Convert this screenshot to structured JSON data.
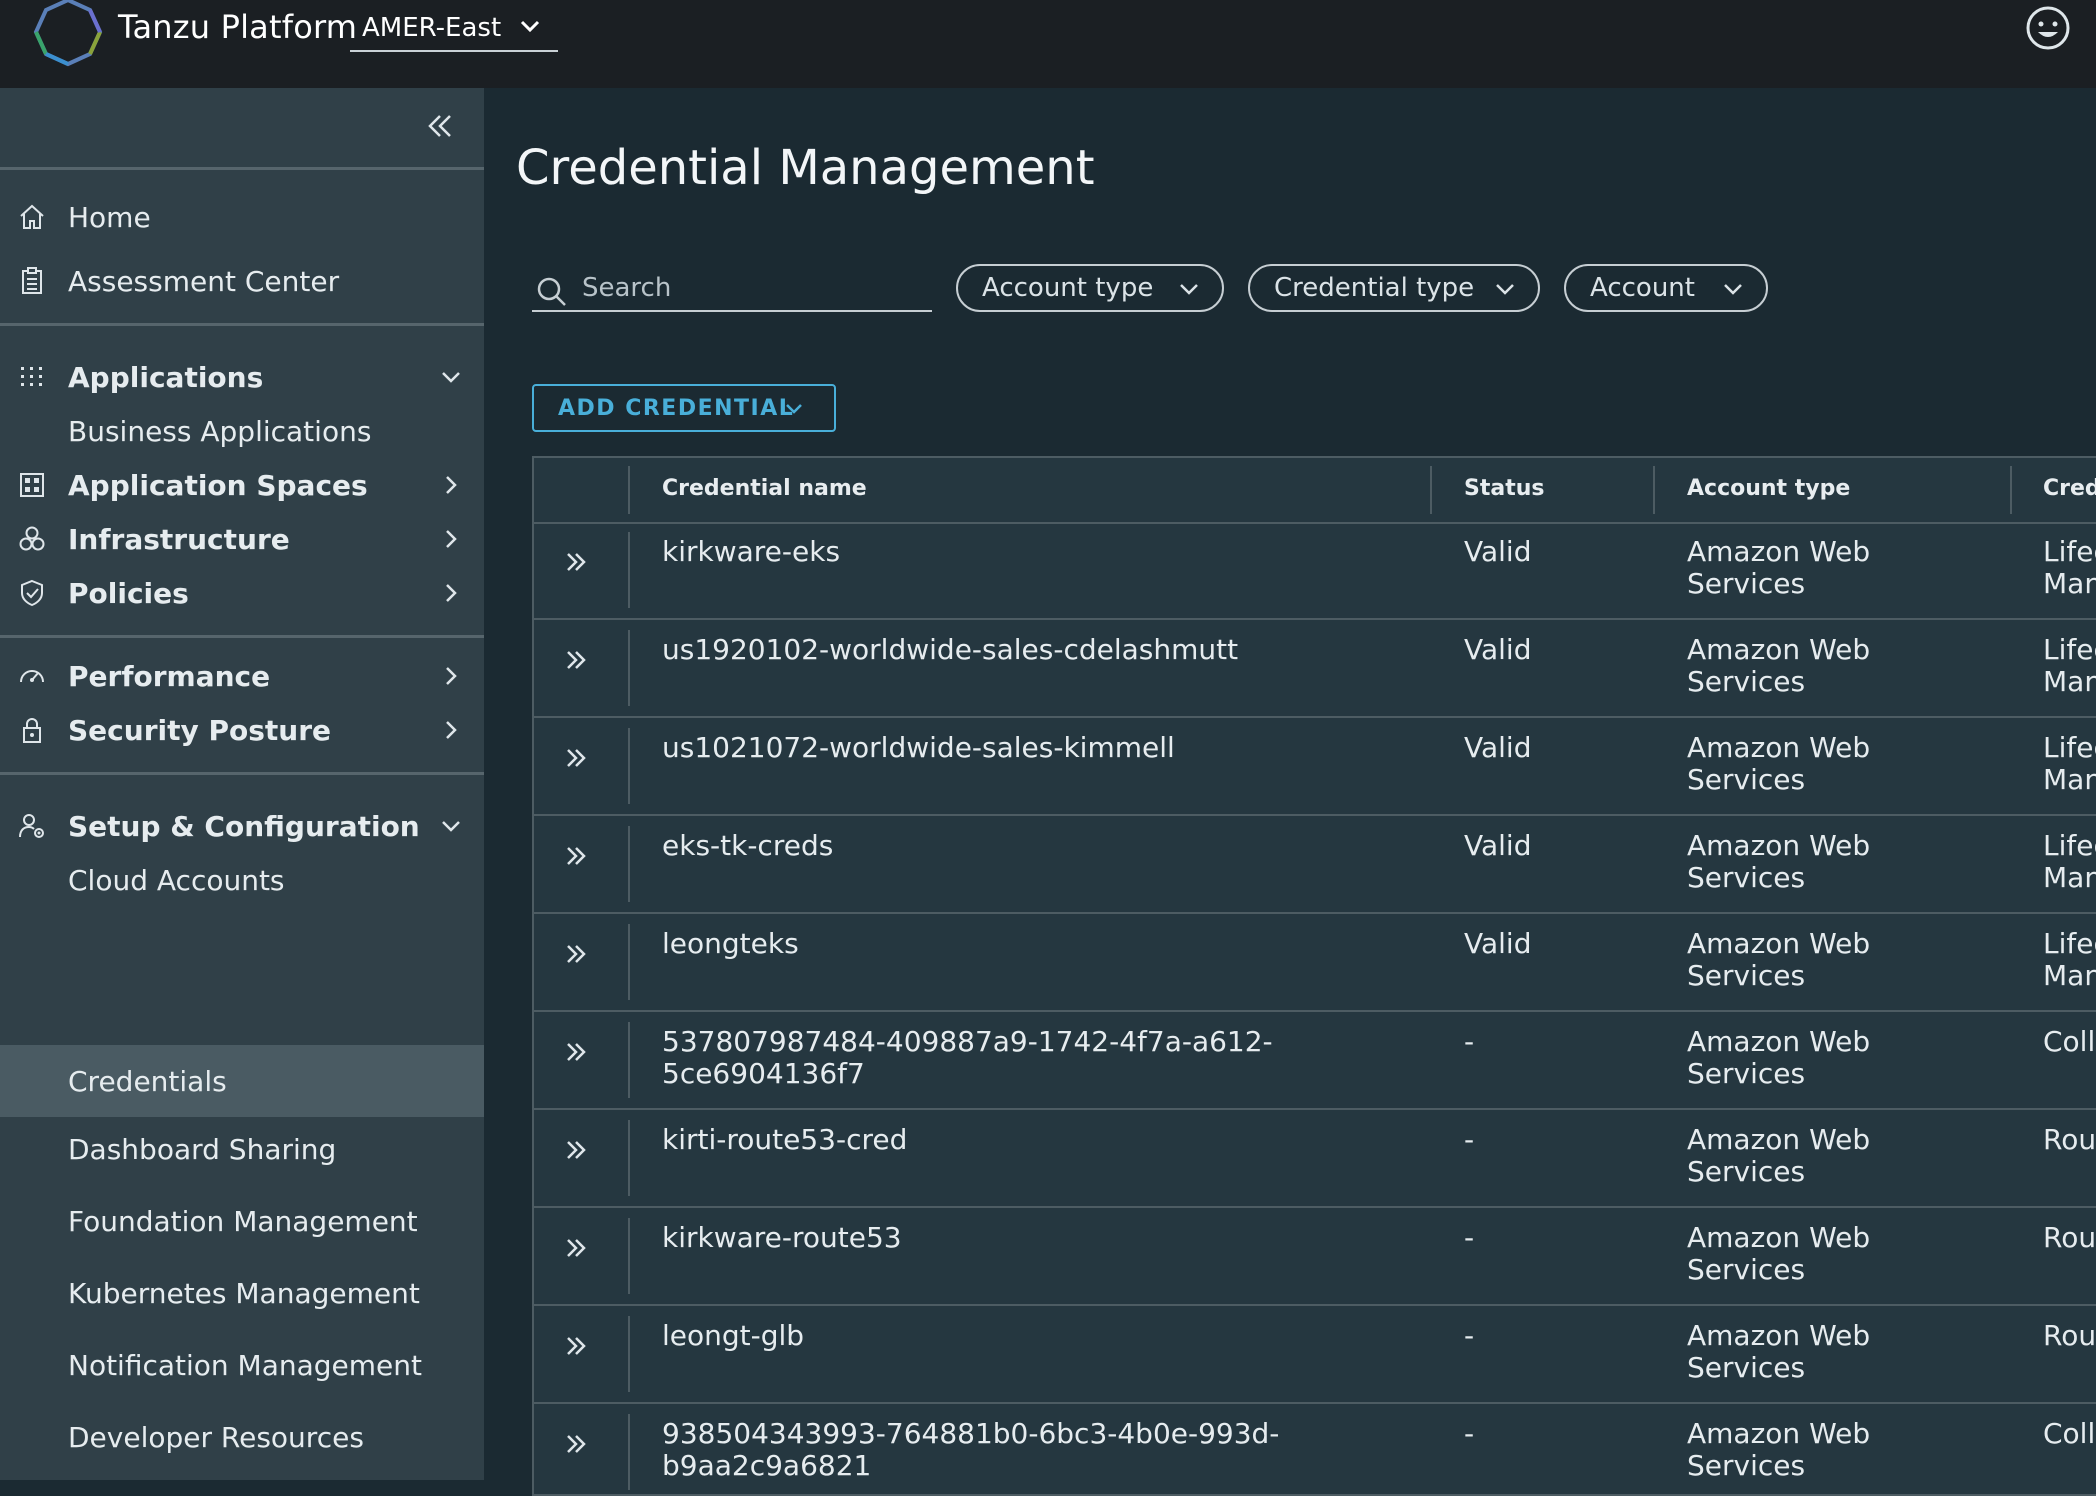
{
  "header": {
    "brand": "Tanzu Platform",
    "region": "AMER-East"
  },
  "sidebar": {
    "items": [
      {
        "label": "Home"
      },
      {
        "label": "Assessment Center"
      },
      {
        "label": "Applications"
      },
      {
        "label": "Business Applications"
      },
      {
        "label": "Application Spaces"
      },
      {
        "label": "Infrastructure"
      },
      {
        "label": "Policies"
      },
      {
        "label": "Performance"
      },
      {
        "label": "Security Posture"
      },
      {
        "label": "Setup & Configuration"
      },
      {
        "label": "Cloud Accounts"
      },
      {
        "label": "Credentials"
      },
      {
        "label": "Dashboard Sharing"
      },
      {
        "label": "Foundation Management"
      },
      {
        "label": "Kubernetes Management"
      },
      {
        "label": "Notification Management"
      },
      {
        "label": "Developer Resources"
      }
    ]
  },
  "main": {
    "title": "Credential Management",
    "search": {
      "placeholder": "Search",
      "value": ""
    },
    "filters": [
      "Account type",
      "Credential type",
      "Account"
    ],
    "add_button": "ADD CREDENTIAL",
    "table": {
      "columns": [
        "Credential name",
        "Status",
        "Account type",
        "Cred"
      ],
      "rows": [
        {
          "name": "kirkware-eks",
          "status": "Valid",
          "account_type": "Amazon Web Services",
          "cred_type": "Lifec\nMan"
        },
        {
          "name": "us1920102-worldwide-sales-cdelashmutt",
          "status": "Valid",
          "account_type": "Amazon Web Services",
          "cred_type": "Lifec\nMan"
        },
        {
          "name": "us1021072-worldwide-sales-kimmell",
          "status": "Valid",
          "account_type": "Amazon Web Services",
          "cred_type": "Lifec\nMan"
        },
        {
          "name": "eks-tk-creds",
          "status": "Valid",
          "account_type": "Amazon Web Services",
          "cred_type": "Lifec\nMan"
        },
        {
          "name": "leongteks",
          "status": "Valid",
          "account_type": "Amazon Web Services",
          "cred_type": "Lifec\nMan"
        },
        {
          "name": "537807987484-409887a9-1742-4f7a-a612-5ce6904136f7",
          "status": "-",
          "account_type": "Amazon Web Services",
          "cred_type": "Colle"
        },
        {
          "name": "kirti-route53-cred",
          "status": "-",
          "account_type": "Amazon Web Services",
          "cred_type": "Rou"
        },
        {
          "name": "kirkware-route53",
          "status": "-",
          "account_type": "Amazon Web Services",
          "cred_type": "Rou"
        },
        {
          "name": "leongt-glb",
          "status": "-",
          "account_type": "Amazon Web Services",
          "cred_type": "Rou"
        },
        {
          "name": "938504343993-764881b0-6bc3-4b0e-993d-b9aa2c9a6821",
          "status": "-",
          "account_type": "Amazon Web Services",
          "cred_type": "Colle"
        }
      ]
    }
  },
  "colors": {
    "header_bg": "#1b1f23",
    "sidebar_bg": "#304048",
    "sidebar_active": "#4a5b63",
    "main_bg": "#1b2a32",
    "accent": "#49afd9"
  },
  "icons": {
    "logo": "tanzu-logo",
    "region_dropdown": "chevron-down-icon",
    "user": "smiley-user-icon",
    "collapse": "double-chevron-left-icon",
    "row_expand": "double-chevron-right-icon"
  }
}
